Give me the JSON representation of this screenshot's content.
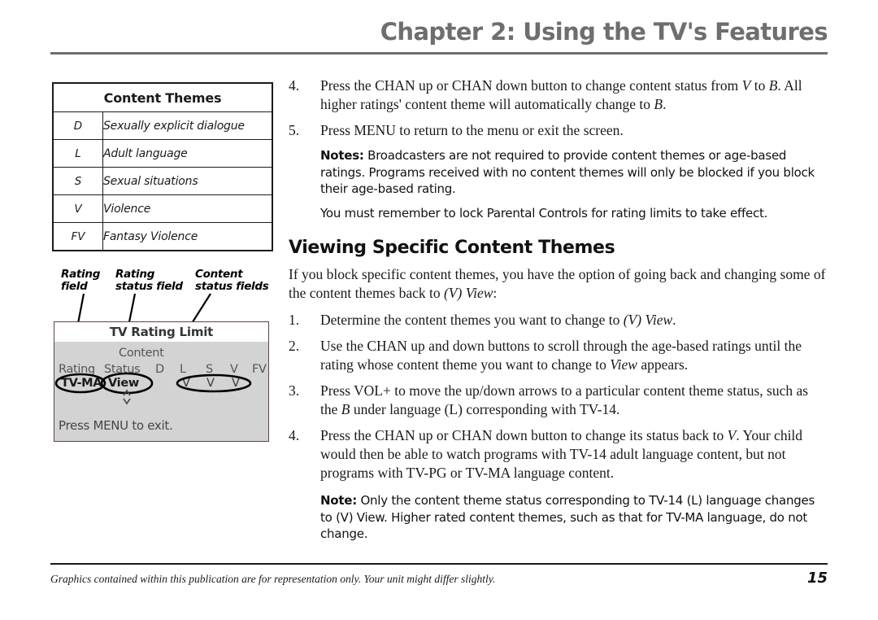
{
  "header": {
    "chapter_title": "Chapter 2: Using the TV's Features"
  },
  "content_themes_table": {
    "title": "Content Themes",
    "rows": [
      {
        "code": "D",
        "description": "Sexually explicit dialogue"
      },
      {
        "code": "L",
        "description": "Adult language"
      },
      {
        "code": "S",
        "description": "Sexual situations"
      },
      {
        "code": "V",
        "description": "Violence"
      },
      {
        "code": "FV",
        "description": "Fantasy Violence"
      }
    ]
  },
  "diagram": {
    "callouts": {
      "rating_field": "Rating\nfield",
      "rating_field_line1": "Rating",
      "rating_field_line2": "field",
      "rating_status_field_line1": "Rating",
      "rating_status_field_line2": "status field",
      "content_status_fields_line1": "Content",
      "content_status_fields_line2": "status fields"
    },
    "tv_screen": {
      "title": "TV Rating Limit",
      "content_group_label": "Content",
      "rating_label": "Rating",
      "status_label": "Status",
      "content_columns": [
        "D",
        "L",
        "S",
        "V",
        "FV"
      ],
      "rating_value": "TV-MA",
      "status_value": "View",
      "content_values": [
        "V",
        "V",
        "V"
      ],
      "exit_text": "Press MENU to exit.",
      "screen_bg": "#d3d3d3",
      "border_color": "#5c4444"
    }
  },
  "main": {
    "steps_top": [
      {
        "number": "4.",
        "text_parts": [
          {
            "t": "Press the CHAN up or CHAN down button to change content status from "
          },
          {
            "t": "V",
            "i": true
          },
          {
            "t": " to "
          },
          {
            "t": "B",
            "i": true
          },
          {
            "t": ". All higher ratings' content theme will automatically change to "
          },
          {
            "t": "B",
            "i": true
          },
          {
            "t": "."
          }
        ]
      },
      {
        "number": "5.",
        "text_parts": [
          {
            "t": "Press MENU to return to the menu or exit the screen."
          }
        ]
      }
    ],
    "notes_1_label": "Notes:",
    "notes_1_text": "Broadcasters are not required to provide content themes or age-based ratings. Programs received with no content themes will only be blocked if you block their age-based rating.",
    "notes_2_text": "You must remember to lock Parental Controls for rating limits to take effect.",
    "section_heading": "Viewing Specific Content Themes",
    "intro_parts": [
      {
        "t": "If you block specific content themes, you have the option of going back and changing some of the content themes back to "
      },
      {
        "t": "(V) View",
        "i": true
      },
      {
        "t": ":"
      }
    ],
    "steps_bottom": [
      {
        "number": "1.",
        "text_parts": [
          {
            "t": "Determine the content themes you want to change to "
          },
          {
            "t": "(V) View",
            "i": true
          },
          {
            "t": "."
          }
        ]
      },
      {
        "number": "2.",
        "text_parts": [
          {
            "t": "Use the CHAN up and down buttons to scroll through the age-based ratings until the rating whose content theme you want to change to "
          },
          {
            "t": "View",
            "i": true
          },
          {
            "t": " appears."
          }
        ]
      },
      {
        "number": "3.",
        "text_parts": [
          {
            "t": "Press VOL+ to move the up/down arrows to a particular content theme status, such as the "
          },
          {
            "t": "B",
            "i": true
          },
          {
            "t": " under language (L) corresponding with TV-14."
          }
        ]
      },
      {
        "number": "4.",
        "text_parts": [
          {
            "t": "Press the CHAN up or CHAN down button to change its status back to "
          },
          {
            "t": "V",
            "i": true
          },
          {
            "t": ".  Your child would then be able to watch programs with TV-14 adult language content, but not programs with TV-PG or TV-MA language content."
          }
        ]
      }
    ],
    "note_final_label": "Note:",
    "note_final_text": "Only the content theme status corresponding to TV-14 (L) language changes to (V) View. Higher rated content themes, such as that for TV-MA language, do not change."
  },
  "footer": {
    "disclaimer": "Graphics contained within this publication are for representation only. Your unit might differ slightly.",
    "page_number": "15"
  }
}
